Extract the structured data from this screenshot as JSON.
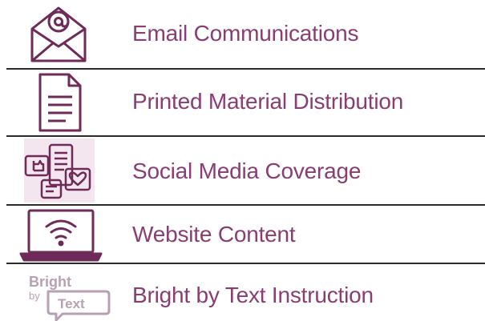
{
  "items": [
    {
      "label": "Email Communications",
      "icon": "email-envelope-icon"
    },
    {
      "label": "Printed Material Distribution",
      "icon": "document-icon"
    },
    {
      "label": "Social Media Coverage",
      "icon": "social-media-icon"
    },
    {
      "label": "Website Content",
      "icon": "laptop-wifi-icon"
    },
    {
      "label": "Bright by Text Instruction",
      "icon": "bright-by-text-logo"
    }
  ],
  "logo": {
    "line1": "Bright",
    "line2": "by",
    "line3": "Text"
  },
  "colors": {
    "accent": "#8a3d73",
    "icon": "#6e2a58",
    "divider": "#2b2b2b",
    "logo": "#b8a0b4"
  }
}
